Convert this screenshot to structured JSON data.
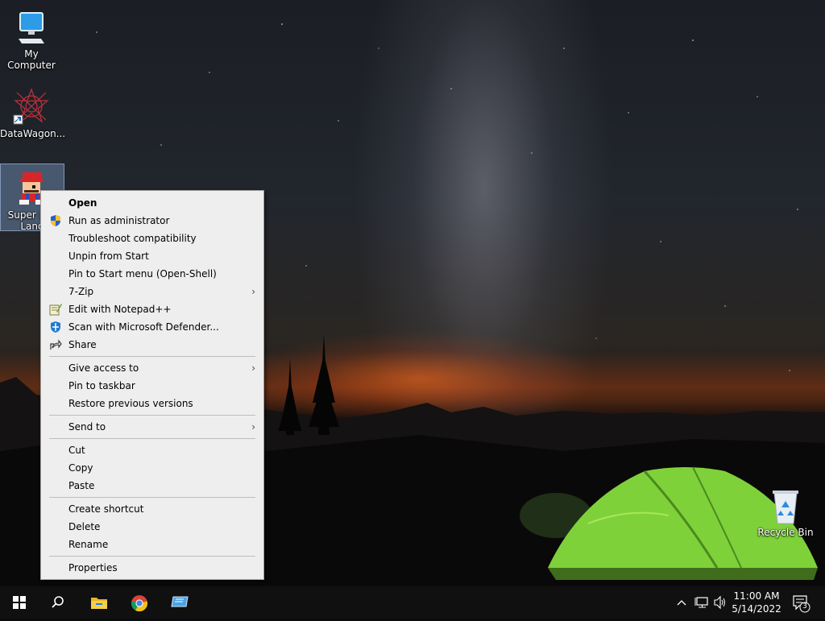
{
  "desktop": {
    "icons": [
      {
        "label": "My Computer"
      },
      {
        "label": "DataWagon..."
      },
      {
        "label": "Super M... Land"
      },
      {
        "label": "Recycle Bin"
      }
    ]
  },
  "context_menu": {
    "items": [
      {
        "label": "Open"
      },
      {
        "label": "Run as administrator"
      },
      {
        "label": "Troubleshoot compatibility"
      },
      {
        "label": "Unpin from Start"
      },
      {
        "label": "Pin to Start menu (Open-Shell)"
      },
      {
        "label": "7-Zip"
      },
      {
        "label": "Edit with Notepad++"
      },
      {
        "label": "Scan with Microsoft Defender..."
      },
      {
        "label": "Share"
      },
      {
        "label": "Give access to"
      },
      {
        "label": "Pin to taskbar"
      },
      {
        "label": "Restore previous versions"
      },
      {
        "label": "Send to"
      },
      {
        "label": "Cut"
      },
      {
        "label": "Copy"
      },
      {
        "label": "Paste"
      },
      {
        "label": "Create shortcut"
      },
      {
        "label": "Delete"
      },
      {
        "label": "Rename"
      },
      {
        "label": "Properties"
      }
    ],
    "submenu_arrow": "›"
  },
  "taskbar": {
    "clock_time": "11:00 AM",
    "clock_date": "5/14/2022",
    "notification_count": "3",
    "pinned_icons": [
      "windows-start-icon",
      "search-icon",
      "file-explorer-icon",
      "chrome-icon",
      "remote-desktop-icon"
    ],
    "tray_icons": [
      "chevron-up-icon",
      "network-icon",
      "volume-icon",
      "notification-icon"
    ]
  }
}
